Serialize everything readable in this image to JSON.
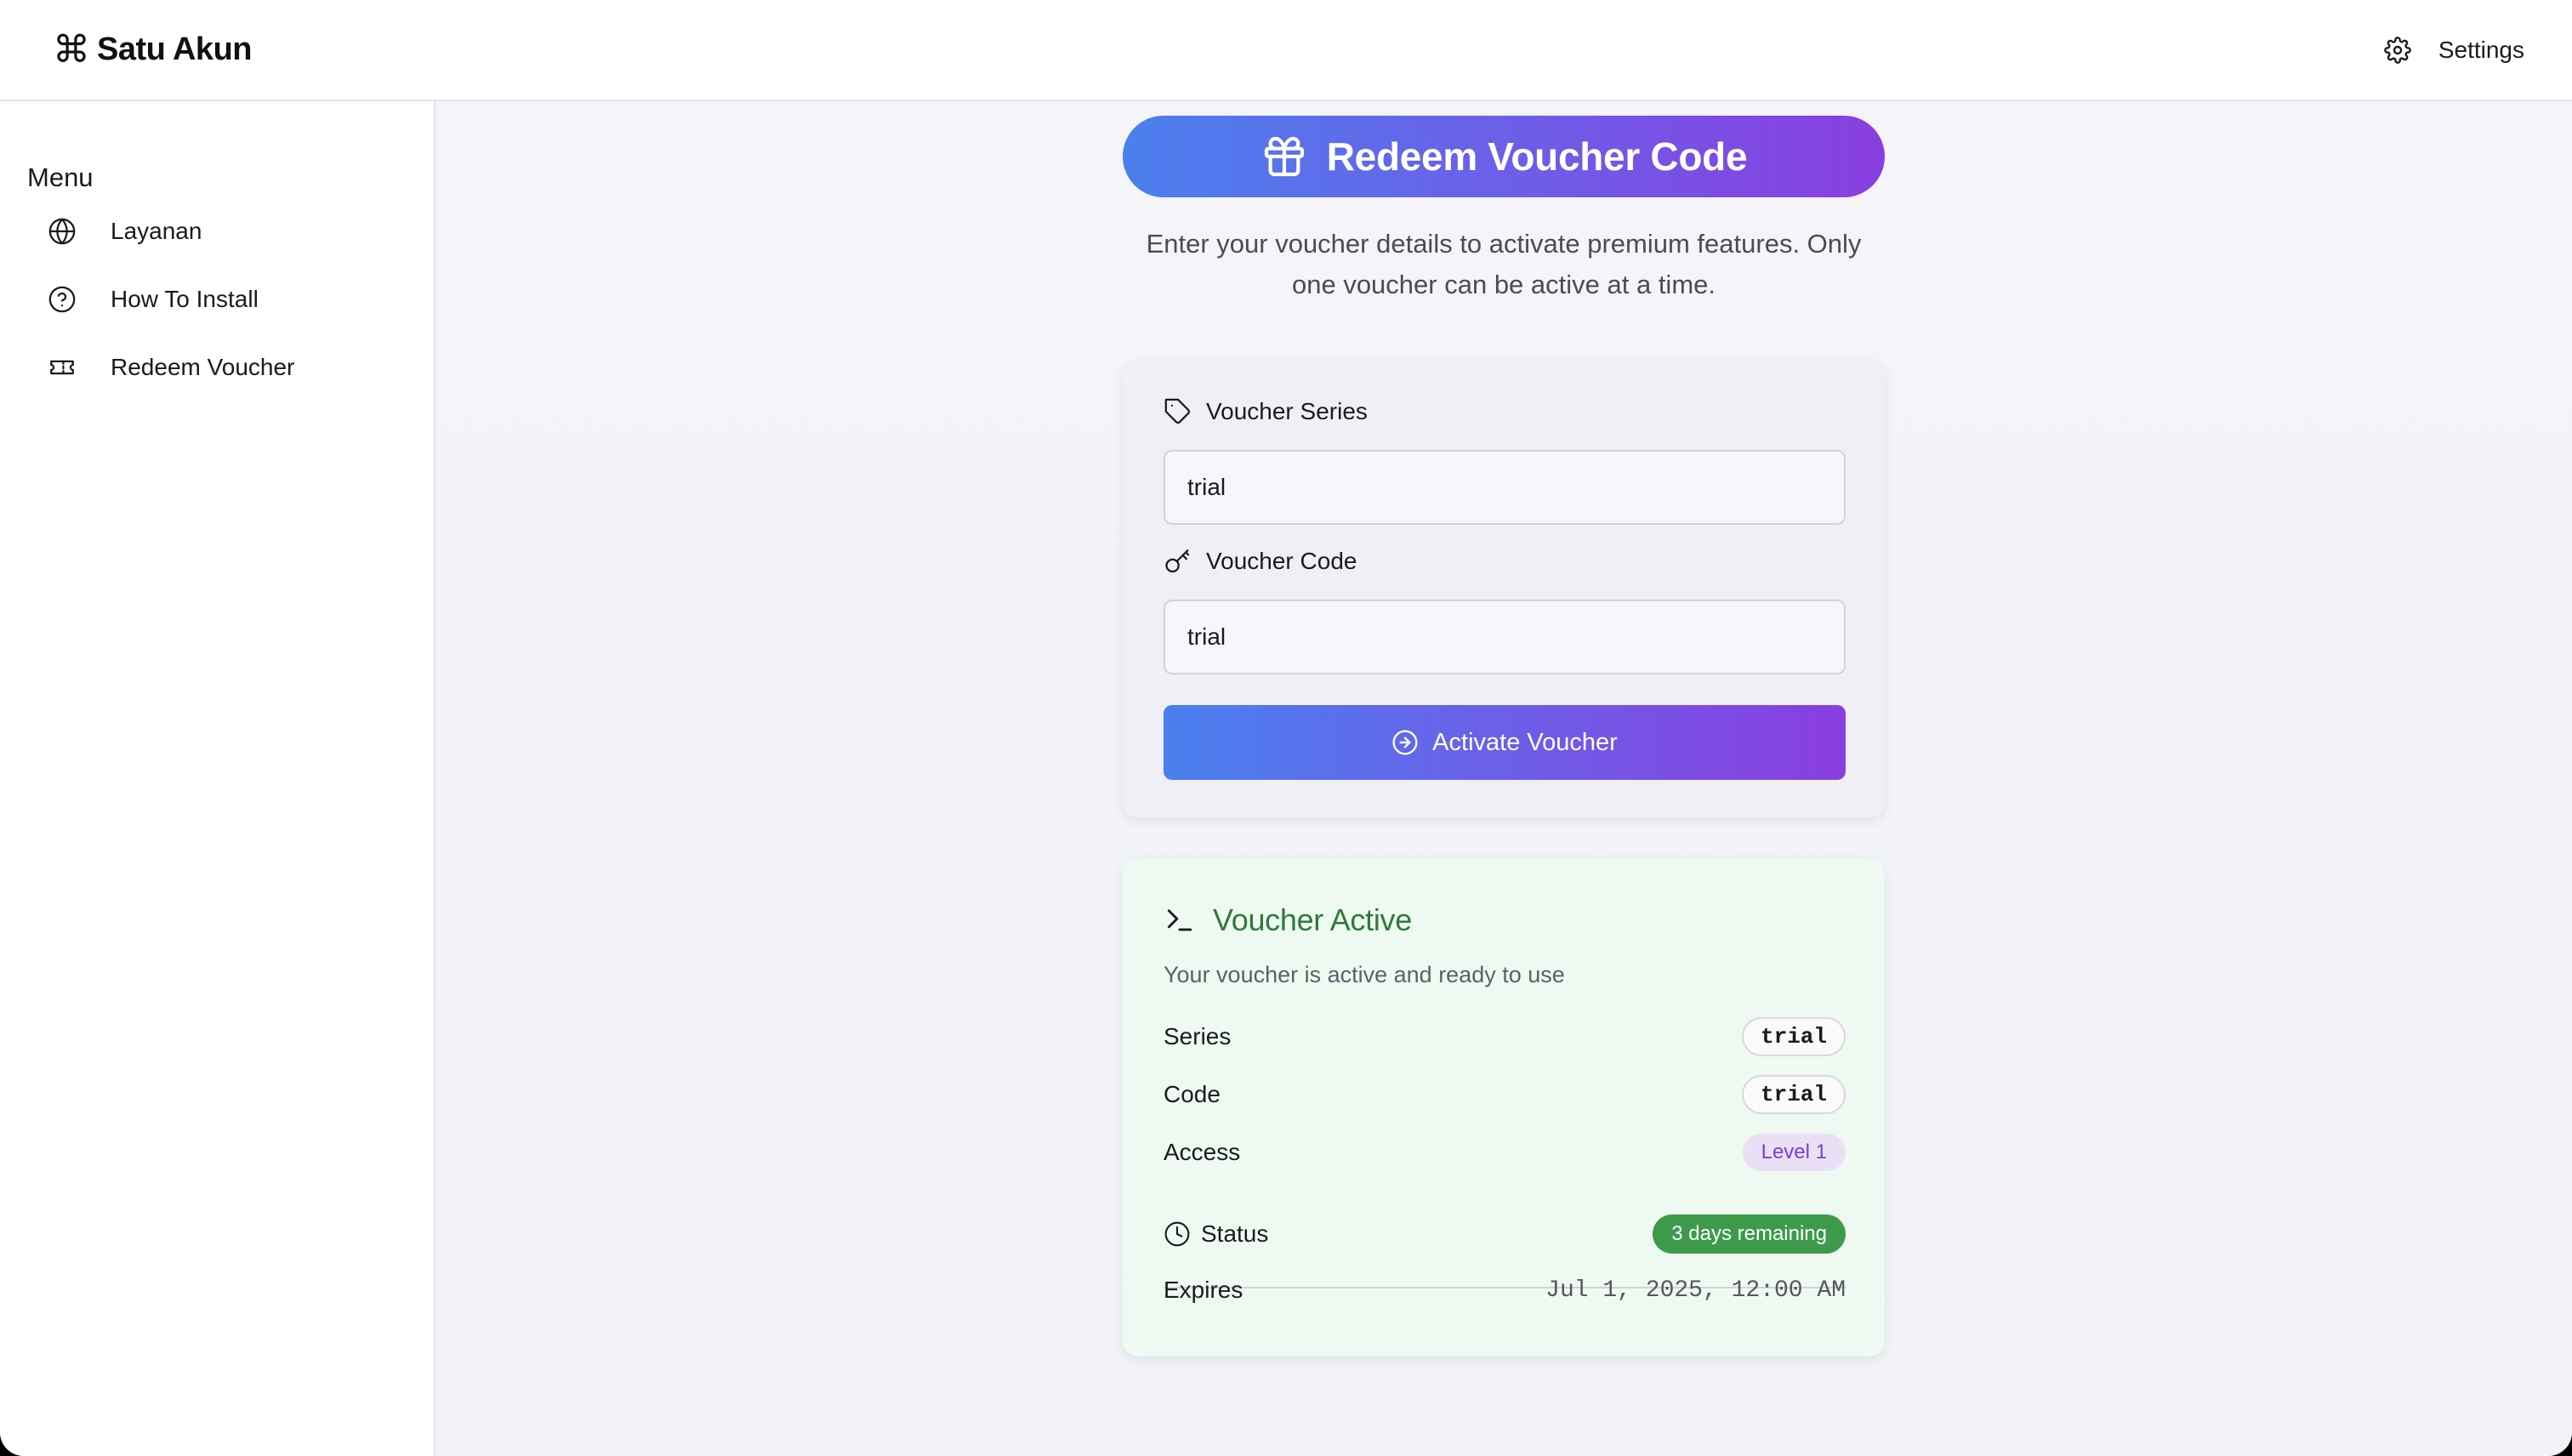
{
  "app": {
    "title": "Satu Akun",
    "brand_icon": "command-icon"
  },
  "header": {
    "settings_label": "Settings",
    "settings_icon": "gear-icon"
  },
  "sidebar": {
    "menu_title": "Menu",
    "items": [
      {
        "label": "Layanan",
        "icon": "globe-icon"
      },
      {
        "label": "How To Install",
        "icon": "help-circle-icon"
      },
      {
        "label": "Redeem Voucher",
        "icon": "ticket-icon"
      }
    ]
  },
  "main": {
    "hero_title": "Redeem Voucher Code",
    "hero_icon": "gift-icon",
    "subtitle": "Enter your voucher details to activate premium features. Only one voucher can be active at a time."
  },
  "form": {
    "series_label": "Voucher Series",
    "series_value": "trial",
    "code_label": "Voucher Code",
    "code_value": "trial",
    "activate_label": "Activate Voucher"
  },
  "status": {
    "title": "Voucher Active",
    "description": "Your voucher is active and ready to use",
    "series_label": "Series",
    "series_value": "trial",
    "code_label": "Code",
    "code_value": "trial",
    "access_label": "Access",
    "access_value": "Level 1",
    "status_label": "Status",
    "status_value": "3 days remaining",
    "expires_label": "Expires",
    "expires_value": "Jul 1, 2025, 12:00 AM"
  },
  "colors": {
    "gradient_start": "#4a80ee",
    "gradient_end": "#8a3ee0",
    "active_green": "#2f7a3c",
    "badge_green": "#3d9a4a",
    "level_purple": "#7a3fd6"
  }
}
